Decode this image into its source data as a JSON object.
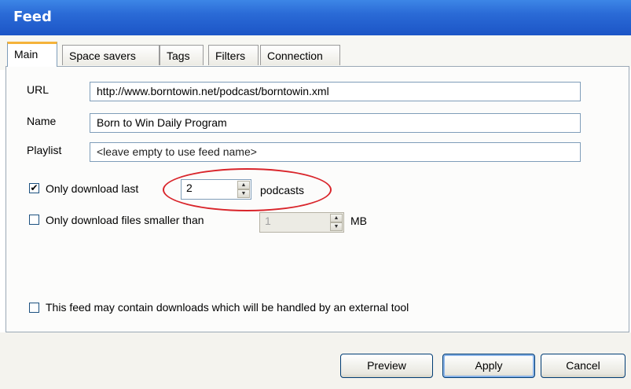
{
  "window": {
    "title": "Feed"
  },
  "tabs": [
    {
      "label": "Main",
      "active": true
    },
    {
      "label": "Space savers",
      "active": false
    },
    {
      "label": "Tags",
      "active": false
    },
    {
      "label": "Filters",
      "active": false
    },
    {
      "label": "Connection",
      "active": false
    }
  ],
  "main": {
    "url_label": "URL",
    "url_value": "http://www.borntowin.net/podcast/borntowin.xml",
    "name_label": "Name",
    "name_value": "Born to Win Daily Program",
    "playlist_label": "Playlist",
    "playlist_placeholder": "<leave empty to use feed name>",
    "only_last": {
      "checked": true,
      "check_glyph": "✔",
      "label": "Only download last",
      "value": "2",
      "suffix": "podcasts"
    },
    "only_smaller": {
      "checked": false,
      "label": "Only download files smaller than",
      "value": "1",
      "suffix": "MB"
    },
    "external_tool": {
      "checked": false,
      "label": "This feed may contain downloads which will be handled by an external tool"
    }
  },
  "footer": {
    "preview_label": "Preview",
    "apply_label": "Apply",
    "cancel_label": "Cancel"
  },
  "colors": {
    "titlebar": "#2a6ad6",
    "highlight_oval": "#d9252b",
    "active_tab_accent": "#f5b33a"
  }
}
